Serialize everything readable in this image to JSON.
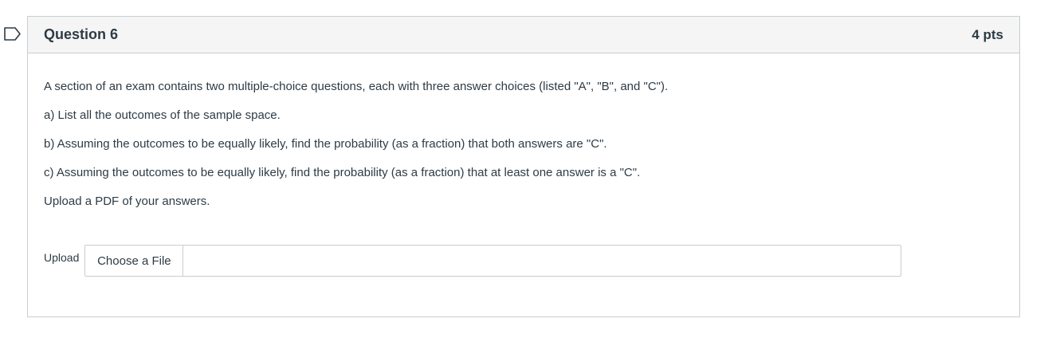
{
  "question": {
    "title": "Question 6",
    "points": "4 pts",
    "paragraphs": [
      "A section of an exam contains two multiple-choice questions, each with three answer choices (listed \"A\", \"B\", and \"C\").",
      "a) List all the outcomes of the sample space.",
      "b) Assuming the outcomes to be equally likely, find the probability (as a fraction) that both answers are \"C\".",
      "c) Assuming the outcomes to be equally likely, find the probability (as a fraction) that at least one answer is a \"C\".",
      "Upload a PDF of your answers."
    ]
  },
  "upload": {
    "label": "Upload",
    "button_label": "Choose a File"
  },
  "colors": {
    "header_bg": "#f5f5f5",
    "border": "#c7cdd1",
    "text": "#2d3b45",
    "bookmark": "#2d3b45"
  },
  "icons": {
    "bookmark": "bookmark-flag-icon"
  }
}
